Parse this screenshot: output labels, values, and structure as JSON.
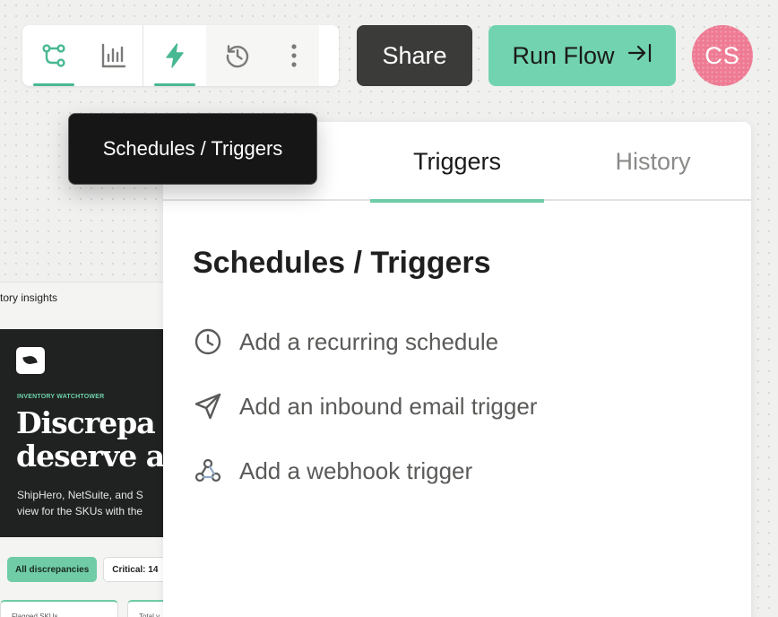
{
  "toolbar": {
    "buttons": [
      {
        "name": "flow-icon",
        "active": true
      },
      {
        "name": "bar-chart-icon",
        "active": false
      },
      {
        "name": "lightning-icon",
        "active": true
      },
      {
        "name": "history-icon",
        "active": false
      },
      {
        "name": "more-vertical-icon",
        "active": false
      }
    ],
    "accent_color": "#48b892"
  },
  "header": {
    "share_label": "Share",
    "run_flow_label": "Run Flow",
    "run_flow_icon": "arrow-right-to-bar-icon",
    "avatar_initials": "CS"
  },
  "tooltip": {
    "text": "Schedules / Triggers"
  },
  "panel": {
    "tabs": [
      {
        "label": "Triggers",
        "active": true
      },
      {
        "label": "History",
        "active": false
      }
    ],
    "heading": "Schedules / Triggers",
    "options": [
      {
        "label": "Add a recurring schedule",
        "icon": "clock-icon"
      },
      {
        "label": "Add an inbound email trigger",
        "icon": "send-icon"
      },
      {
        "label": "Add a webhook trigger",
        "icon": "webhook-icon"
      }
    ]
  },
  "preview": {
    "title": "tory insights",
    "eyebrow": "INVENTORY WATCHTOWER",
    "headline_lines": [
      "Discrepa",
      "deserve a"
    ],
    "body_lines": [
      "ShipHero, NetSuite, and S",
      "view for the SKUs with the"
    ],
    "chips": [
      "All discrepancies",
      "Critical: 14"
    ],
    "stats": [
      "Flagged SKUs",
      "Total v"
    ]
  },
  "colors": {
    "run_flow_bg": "#72d3b0",
    "share_bg": "#3b3b3a",
    "avatar_bg": "#ee7a93",
    "tab_underline": "#6fcca6"
  }
}
